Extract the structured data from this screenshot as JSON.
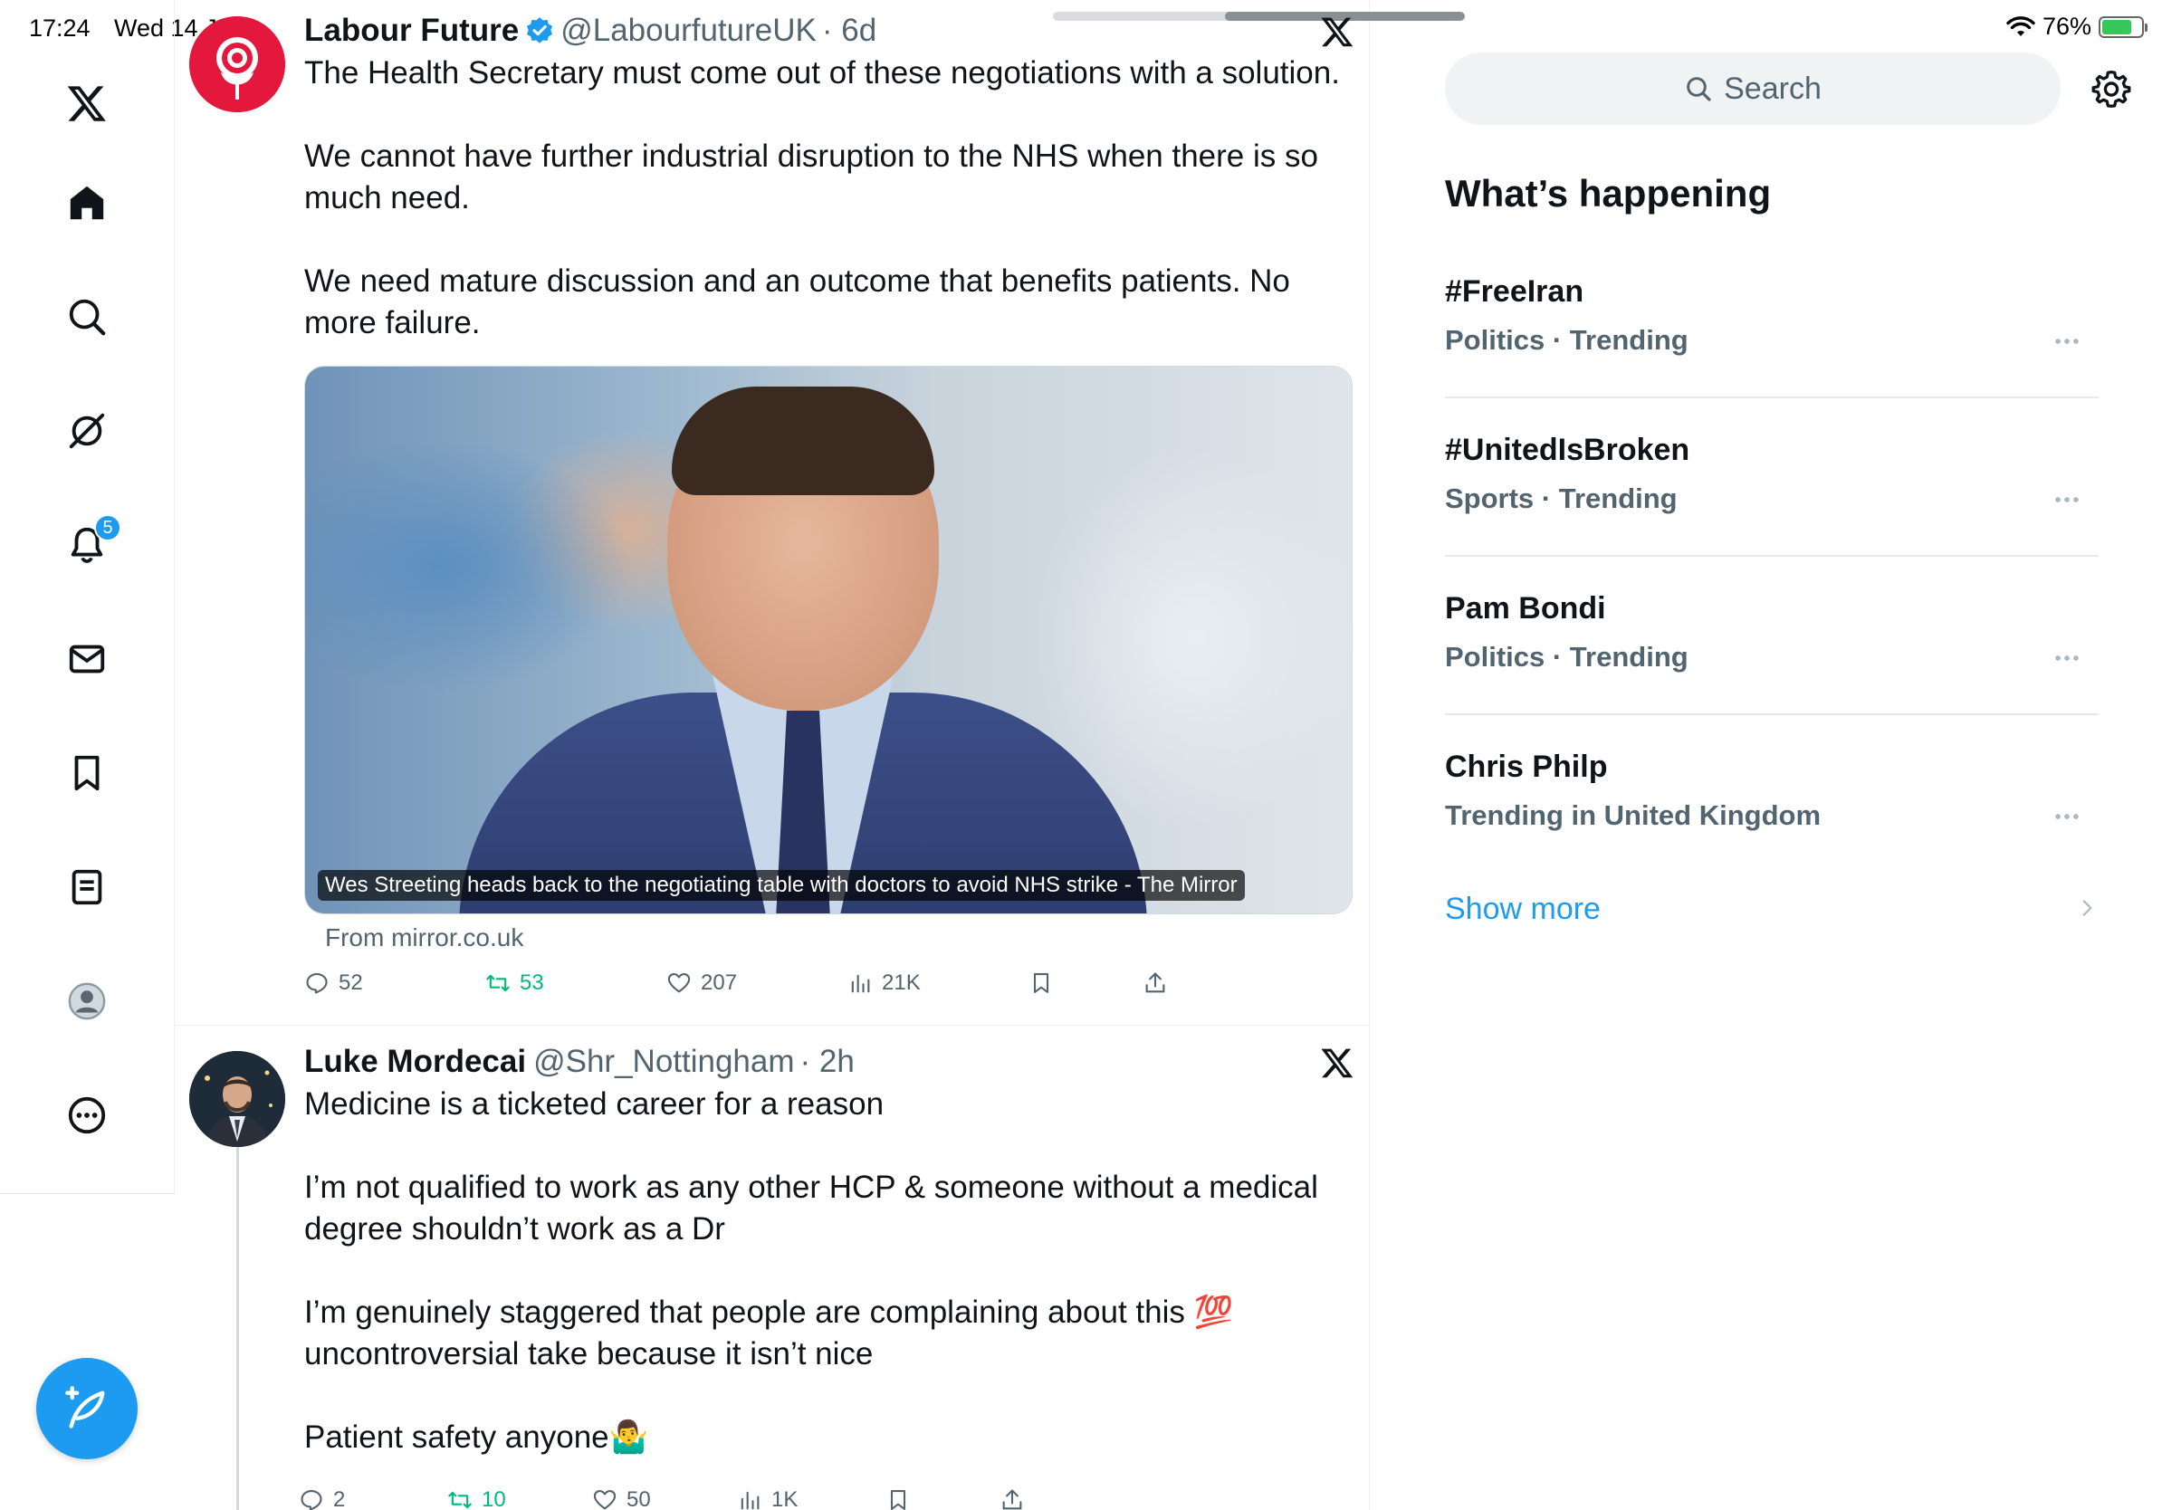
{
  "status_bar": {
    "time": "17:24",
    "date": "Wed 14 Jan",
    "battery": "76%",
    "battery_level": 0.76
  },
  "nav": {
    "notifications_badge": "5",
    "colors": {
      "accent": "#1d9bf0",
      "icon": "#0f1419"
    },
    "items": [
      "x-logo",
      "home-icon",
      "search-icon",
      "grok-icon",
      "notifications-icon",
      "messages-icon",
      "bookmarks-icon",
      "lists-icon",
      "profile-icon",
      "more-icon"
    ],
    "compose_icon": "compose-icon"
  },
  "tweets": [
    {
      "name": "Labour Future",
      "verified": true,
      "handle": "@LabourfutureUK",
      "time": "· 6d",
      "text": "The Health Secretary must come out of these negotiations with a solution.\n\nWe cannot have further industrial disruption to the NHS when there is so much need.\n\nWe need mature discussion and an outcome that benefits patients. No more failure.",
      "card_caption": "Wes Streeting heads back to the negotiating table with doctors to avoid NHS strike - The Mirror",
      "card_source": "From mirror.co.uk",
      "replies": "52",
      "retweets": "53",
      "likes": "207",
      "views": "21K"
    },
    {
      "name": "Luke Mordecai",
      "handle": "@Shr_Nottingham",
      "time": "· 2h",
      "text": "Medicine is a ticketed career for a reason\n\nI’m not qualified to work as any other HCP & someone without a medical degree shouldn’t work as a Dr\n\nI’m genuinely staggered that people are complaining about this 💯 uncontroversial take because it isn’t nice\n\nPatient safety anyone🤷‍♂️",
      "replies": "2",
      "retweets": "10",
      "likes": "50",
      "views": "1K"
    }
  ],
  "sidebar": {
    "search_placeholder": "Search",
    "title": "What’s happening",
    "trends": [
      {
        "name": "#FreeIran",
        "meta": "Politics · Trending"
      },
      {
        "name": "#UnitedIsBroken",
        "meta": "Sports · Trending"
      },
      {
        "name": "Pam Bondi",
        "meta": "Politics · Trending"
      },
      {
        "name": "Chris Philp",
        "meta": "Trending in United Kingdom"
      }
    ],
    "show_more": "Show more"
  }
}
